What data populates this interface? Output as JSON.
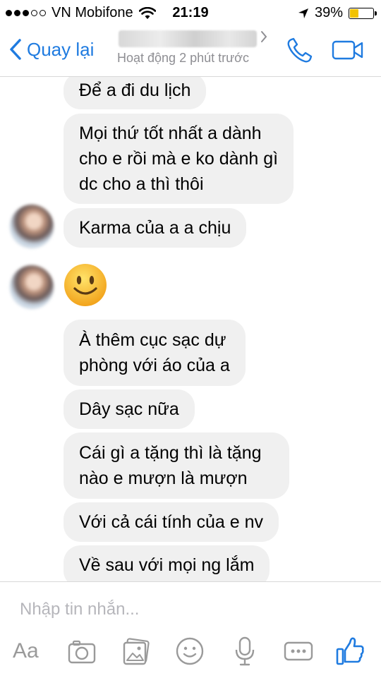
{
  "status_bar": {
    "carrier": "VN Mobifone",
    "time": "21:19",
    "battery_percent": "39%",
    "battery_level": 0.39,
    "signal_bars_filled": 3,
    "icons": [
      "signal-dots-icon",
      "wifi-icon",
      "location-arrow-icon",
      "battery-icon"
    ]
  },
  "header": {
    "back_label": "Quay lại",
    "status": "Hoạt động 2 phút trước",
    "icons": [
      "chevron-left-icon",
      "chevron-right-icon",
      "phone-icon",
      "video-camera-icon"
    ],
    "accent_color": "#1f7be0"
  },
  "messages": [
    {
      "text": "Để a đi du lịch"
    },
    {
      "text": "Mọi thứ tốt nhất a dành cho e rồi mà e ko dành gì dc cho a thì thôi",
      "lines": [
        "Mọi thứ tốt nhất a dành",
        "cho e rồi mà e ko dành gì",
        "dc cho a thì thôi"
      ]
    },
    {
      "text": "Karma của a a chịu"
    },
    {
      "emoji": "smiling-face-emoji"
    },
    {
      "text": "À thêm cục sạc dự phòng với áo của a",
      "lines": [
        "À thêm cục sạc dự",
        "phòng với áo của a"
      ]
    },
    {
      "text": "Dây sạc nữa"
    },
    {
      "text": "Cái gì a tặng thì là tặng nào e mượn là mượn",
      "lines": [
        "Cái gì a tặng thì là tặng",
        "nào e mượn là mượn"
      ]
    },
    {
      "text": "Với cả cái tính của e nv"
    },
    {
      "text": "Về sau với mọi ng lắm"
    }
  ],
  "composer": {
    "placeholder": "Nhập tin nhắn...",
    "value": "",
    "aa_label": "Aa",
    "toolbar_icons": [
      "camera-icon",
      "photo-gallery-icon",
      "emoji-icon",
      "microphone-icon",
      "more-icon",
      "thumbs-up-icon"
    ]
  },
  "colors": {
    "bubble": "#f0f0f0",
    "icon_gray": "#9a9a9a",
    "messenger_blue": "#1f7be0"
  }
}
